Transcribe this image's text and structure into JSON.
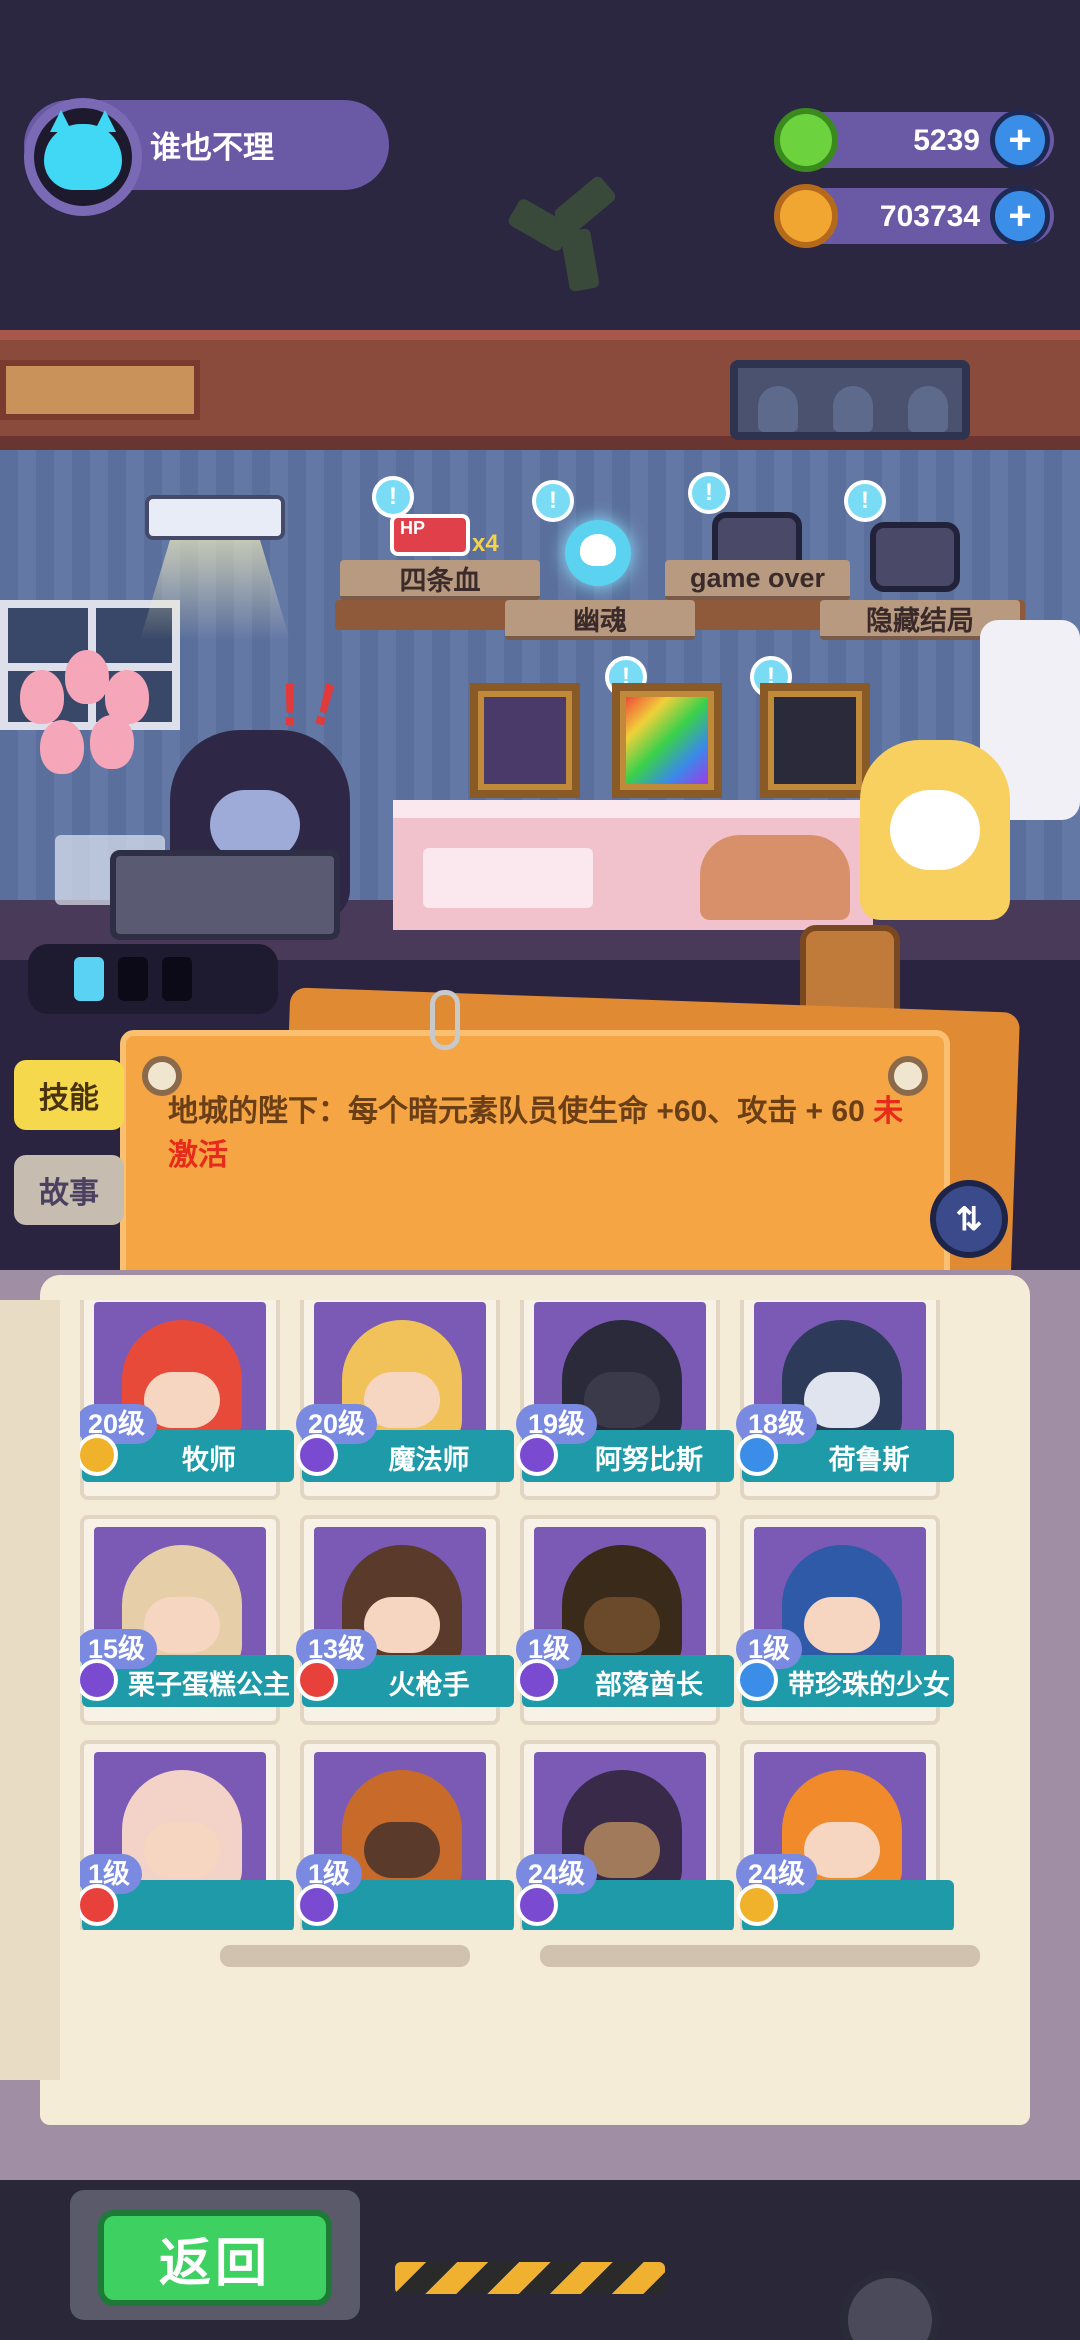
{
  "player": {
    "name": "谁也不理",
    "avatar_icon": "cat-avatar-icon"
  },
  "currencies": [
    {
      "icon": "green-gem-icon",
      "value": "5239",
      "color": "#6cd23e"
    },
    {
      "icon": "gold-coin-icon",
      "value": "703734",
      "color": "#f2a632"
    }
  ],
  "room": {
    "signs": [
      "四条血",
      "幽魂",
      "game over",
      "隐藏结局"
    ],
    "hp_item": {
      "label": "HP",
      "count": "x4"
    }
  },
  "tabs": {
    "skill": "技能",
    "story": "故事"
  },
  "skill": {
    "text": "地城的陛下：每个暗元素队员使生命 +60、攻击 + 60",
    "status": "未激活",
    "status_color": "#e82a1a"
  },
  "heroes": [
    {
      "name": "牧师",
      "level": "20级",
      "element": "gold",
      "color": "#e84a3a"
    },
    {
      "name": "魔法师",
      "level": "20级",
      "element": "purple",
      "color": "#f2c25a"
    },
    {
      "name": "阿努比斯",
      "level": "19级",
      "element": "purple",
      "color": "#2a2a3a"
    },
    {
      "name": "荷鲁斯",
      "level": "18级",
      "element": "blue",
      "color": "#2e3a5a"
    },
    {
      "name": "栗子蛋糕公主",
      "level": "15级",
      "element": "purple",
      "color": "#e6cfa8"
    },
    {
      "name": "火枪手",
      "level": "13级",
      "element": "red",
      "color": "#5a3a2a"
    },
    {
      "name": "部落酋长",
      "level": "1级",
      "element": "purple",
      "color": "#3a2a1a"
    },
    {
      "name": "带珍珠的少女",
      "level": "1级",
      "element": "blue",
      "color": "#2e5aa8"
    },
    {
      "name": "",
      "level": "1级",
      "element": "red",
      "color": "#f3d2c8"
    },
    {
      "name": "",
      "level": "1级",
      "element": "purple",
      "color": "#c86a2a"
    },
    {
      "name": "",
      "level": "24级",
      "element": "purple",
      "color": "#3a2a4a"
    },
    {
      "name": "",
      "level": "24级",
      "element": "gold",
      "color": "#f08a2a"
    }
  ],
  "element_colors": {
    "gold": "#f0b22a",
    "purple": "#7a4ad0",
    "blue": "#3a8ee8",
    "red": "#e8403a"
  },
  "buttons": {
    "back": "返回"
  }
}
